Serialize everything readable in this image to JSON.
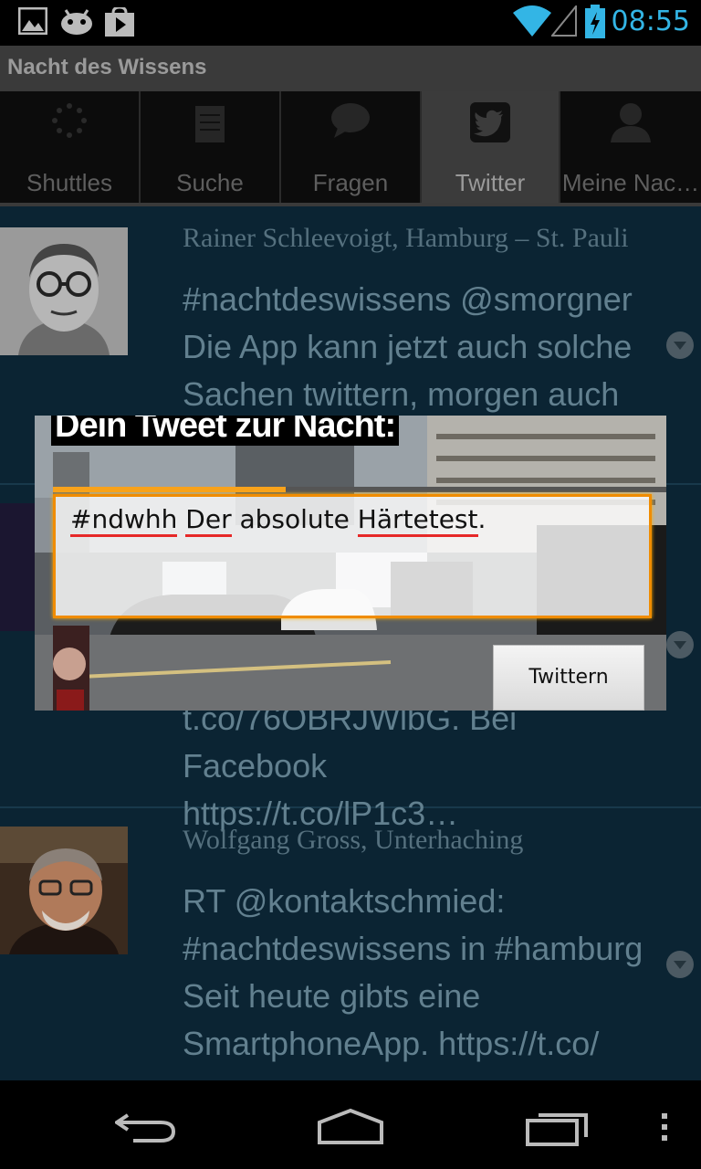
{
  "status_bar": {
    "icons": [
      "gallery-icon",
      "android-icon",
      "play-store-icon",
      "wifi-icon",
      "signal-icon",
      "battery-charging-icon"
    ],
    "time": "08:55",
    "accent": "#33b5e5"
  },
  "app": {
    "title": "Nacht des Wissens"
  },
  "tabs": [
    {
      "label": "Shuttles",
      "icon": "loading-icon"
    },
    {
      "label": "Suche",
      "icon": "notepad-icon"
    },
    {
      "label": "Fragen",
      "icon": "speech-bubble-icon"
    },
    {
      "label": "Twitter",
      "icon": "twitter-icon",
      "selected": true
    },
    {
      "label": "Meine Nac…",
      "icon": "person-icon"
    }
  ],
  "tweets": [
    {
      "author": "Rainer Schleevoigt, Hamburg – St. Pauli",
      "lines": [
        "#nachtdeswissens @smorgner",
        "Die App kann jetzt auch solche",
        "Sachen twittern, morgen auch mit"
      ]
    },
    {
      "lines": [
        "t.co/76OBRJWlbG. Bei Facebook",
        "https://t.co/lP1c3…"
      ]
    },
    {
      "author": "Wolfgang Gross, Unterhaching",
      "lines": [
        "RT @kontaktschmied:",
        "#nachtdeswissens in #hamburg",
        "Seit heute gibts eine",
        "SmartphoneApp. https://t.co/"
      ]
    }
  ],
  "dialog": {
    "title": "Dein Tweet zur Nacht:",
    "input_parts": [
      "#ndwhh",
      "Der",
      "absolute",
      "Härtetest",
      "."
    ],
    "progress": 0.38,
    "button_label": "Twittern",
    "accent": "#f08c00"
  },
  "nav_bar": {
    "icons": [
      "back-icon",
      "home-icon",
      "recent-apps-icon",
      "overflow-menu-icon"
    ]
  }
}
